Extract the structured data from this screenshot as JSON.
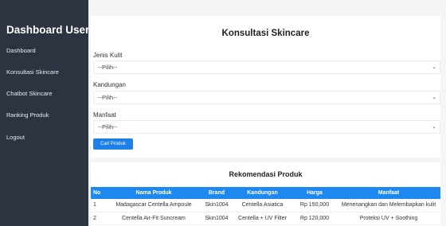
{
  "sidebar": {
    "brand": "Dashboard User",
    "items": [
      {
        "label": "Dashboard"
      },
      {
        "label": "Konsultasi Skincare"
      },
      {
        "label": "Chatbot Skincare"
      },
      {
        "label": "Ranking Produk"
      },
      {
        "label": "Logout"
      }
    ]
  },
  "form": {
    "title": "Konsultasi Skincare",
    "fields": [
      {
        "label": "Jenis Kulit",
        "value": "--Pilih--"
      },
      {
        "label": "Kandungan",
        "value": "--Pilih--"
      },
      {
        "label": "Manfaat",
        "value": "--Pilih--"
      }
    ],
    "button_label": "Cari Produk"
  },
  "results": {
    "title": "Rekomendasi Produk",
    "columns": [
      "No",
      "Nama Produk",
      "Brand",
      "Kandungan",
      "Harga",
      "Manfaat"
    ],
    "rows": [
      [
        "1",
        "Madagascar Centella Ampoule",
        "Skin1004",
        "Centella Asiatica",
        "Rp 150,000",
        "Menenangkan dan Melembapkan kulit"
      ],
      [
        "2",
        "Centella Air-Fit Suncream",
        "Skin1004",
        "Centella + UV Filter",
        "Rp 120,000",
        "Proteksi UV + Soothing"
      ]
    ]
  },
  "colors": {
    "sidebar_bg": "#2b3440",
    "accent": "#1e88f0"
  }
}
